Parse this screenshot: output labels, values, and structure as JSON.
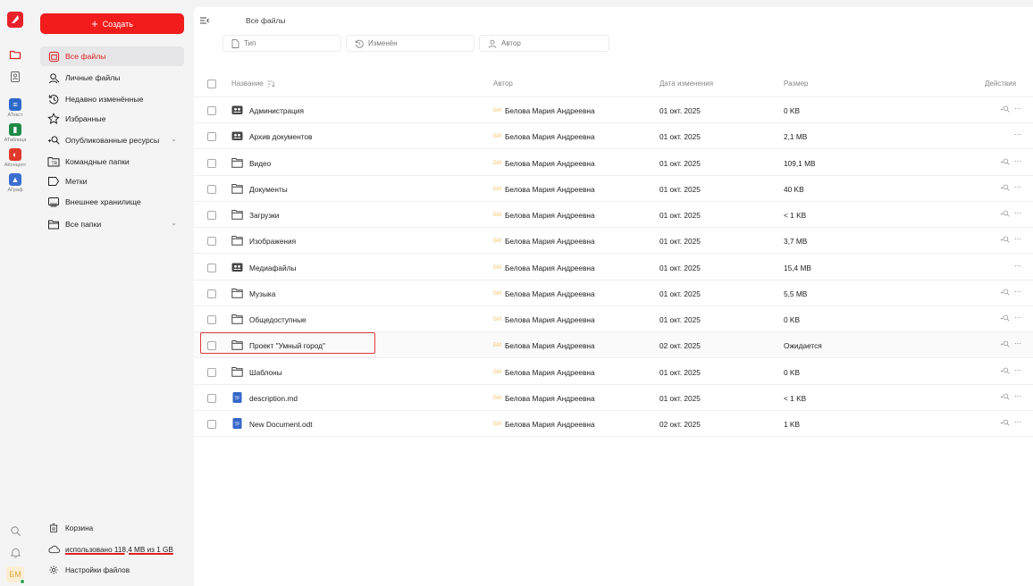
{
  "rail": {
    "apps": [
      {
        "label": "АТекст",
        "icon": "document-icon",
        "color": "#2d69c9",
        "glyph": "≡"
      },
      {
        "label": "АТаблица",
        "icon": "spreadsheet-icon",
        "color": "#1f8a47",
        "glyph": "▮"
      },
      {
        "label": "АКонцепт",
        "icon": "presentation-icon",
        "color": "#e0392b",
        "glyph": "◐"
      },
      {
        "label": "АГраф",
        "icon": "image-icon",
        "color": "#3a6ed1",
        "glyph": "▲"
      }
    ],
    "user_initials": "БМ"
  },
  "sidebar": {
    "create_label": "Создать",
    "items": [
      {
        "label": "Все файлы",
        "icon": "folder-icon"
      },
      {
        "label": "Личные файлы",
        "icon": "user-icon"
      },
      {
        "label": "Недавно изменённые",
        "icon": "history-icon"
      },
      {
        "label": "Избранные",
        "icon": "star-icon"
      },
      {
        "label": "Опубликованные ресурсы",
        "icon": "share-icon"
      },
      {
        "label": "Командные папки",
        "icon": "team-folder-icon"
      },
      {
        "label": "Метки",
        "icon": "tag-icon"
      },
      {
        "label": "Внешнее хранилище",
        "icon": "external-storage-icon"
      },
      {
        "label": "Все папки",
        "icon": "folders-icon"
      }
    ],
    "trash_label": "Корзина",
    "storage_label": "использовано 118,4 MB из 1 GB",
    "settings_label": "Настройки файлов"
  },
  "main": {
    "breadcrumb": "Все файлы",
    "filters": [
      {
        "label": "Тип",
        "icon": "file-icon"
      },
      {
        "label": "Изменён",
        "icon": "history-icon"
      },
      {
        "label": "Автор",
        "icon": "user-icon"
      }
    ],
    "columns": {
      "name": "Название",
      "author": "Автор",
      "date": "Дата изменения",
      "size": "Размер",
      "actions": "Действия"
    },
    "rows": [
      {
        "name": "Администрация",
        "kind": "team",
        "author": "Белова Мария Андреевна",
        "initials": "БМ",
        "date": "01 окт. 2025",
        "size": "0 KB",
        "shareable": true
      },
      {
        "name": "Архив документов",
        "kind": "team",
        "author": "Белова Мария Андреевна",
        "initials": "БМ",
        "date": "01 окт. 2025",
        "size": "2,1 MB",
        "shareable": false
      },
      {
        "name": "Видео",
        "kind": "folder",
        "author": "Белова Мария Андреевна",
        "initials": "БМ",
        "date": "01 окт. 2025",
        "size": "109,1 MB",
        "shareable": true
      },
      {
        "name": "Документы",
        "kind": "folder",
        "author": "Белова Мария Андреевна",
        "initials": "БМ",
        "date": "01 окт. 2025",
        "size": "40 KB",
        "shareable": true
      },
      {
        "name": "Загрузки",
        "kind": "folder",
        "author": "Белова Мария Андреевна",
        "initials": "БМ",
        "date": "01 окт. 2025",
        "size": "< 1 KB",
        "shareable": true
      },
      {
        "name": "Изображения",
        "kind": "folder",
        "author": "Белова Мария Андреевна",
        "initials": "БМ",
        "date": "01 окт. 2025",
        "size": "3,7 MB",
        "shareable": true
      },
      {
        "name": "Медиафайлы",
        "kind": "team",
        "author": "Белова Мария Андреевна",
        "initials": "БМ",
        "date": "01 окт. 2025",
        "size": "15,4 MB",
        "shareable": false
      },
      {
        "name": "Музыка",
        "kind": "folder",
        "author": "Белова Мария Андреевна",
        "initials": "БМ",
        "date": "01 окт. 2025",
        "size": "5,5 MB",
        "shareable": true
      },
      {
        "name": "Общедоступные",
        "kind": "folder",
        "author": "Белова Мария Андреевна",
        "initials": "БМ",
        "date": "01 окт. 2025",
        "size": "0 KB",
        "shareable": true
      },
      {
        "name": "Проект \"Умный город\"",
        "kind": "folder",
        "author": "Белова Мария Андреевна",
        "initials": "БМ",
        "date": "02 окт. 2025",
        "size": "Ожидается",
        "shareable": true,
        "hovered": true
      },
      {
        "name": "Шаблоны",
        "kind": "folder",
        "author": "Белова Мария Андреевна",
        "initials": "БМ",
        "date": "01 окт. 2025",
        "size": "0 KB",
        "shareable": true
      },
      {
        "name": "description.md",
        "kind": "doc",
        "author": "Белова Мария Андреевна",
        "initials": "БМ",
        "date": "01 окт. 2025",
        "size": "< 1 KB",
        "shareable": true
      },
      {
        "name": "New Document.odt",
        "kind": "doc",
        "author": "Белова Мария Андреевна",
        "initials": "БМ",
        "date": "02 окт. 2025",
        "size": "1 KB",
        "shareable": true
      }
    ]
  },
  "colors": {
    "accent": "#f21c1c",
    "highlight_border": "#e0393a",
    "doc_blue": "#3465c8",
    "initials": "#f2c36b"
  }
}
